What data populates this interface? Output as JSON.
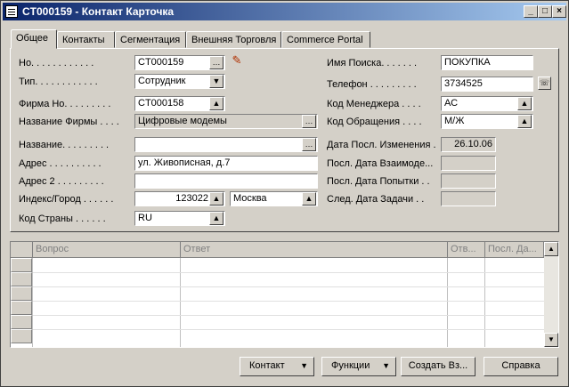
{
  "window": {
    "title": "CT000159 - Контакт Карточка",
    "controls": [
      "_",
      "□",
      "×"
    ]
  },
  "tabs": [
    {
      "label": "Общее"
    },
    {
      "label": "Контакты"
    },
    {
      "label": "Сегментация"
    },
    {
      "label": "Внешняя Торговля"
    },
    {
      "label": "Commerce Portal"
    }
  ],
  "general": {
    "no_label": "Но. . . . . . . . . . . .",
    "no_value": "CT000159",
    "type_label": "Тип. . . . . . . . . . . .",
    "type_value": "Сотрудник",
    "company_no_label": "Фирма Но. . . . . . . . .",
    "company_no_value": "CT000158",
    "company_name_label": "Название Фирмы . . . .",
    "company_name_value": "Цифровые модемы",
    "name_label": "Название. . . . . . . . .",
    "name_value": "",
    "address_label": "Адрес . . . . . . . . . .",
    "address_value": "ул. Живописная, д.7",
    "address2_label": "Адрес 2 . . . . . . . . .",
    "address2_value": "",
    "postcode_label": "Индекс/Город . . . . . .",
    "postcode_value": "123022",
    "city_value": "Москва",
    "country_label": "Код Страны . . . . . .",
    "country_value": "RU",
    "search_name_label": "Имя Поиска. . . . . . .",
    "search_name_value": "ПОКУПКА",
    "phone_label": "Телефон . . . . . . . . .",
    "phone_value": "3734525",
    "manager_label": "Код Менеджера . . . .",
    "manager_value": "АС",
    "salutation_label": "Код Обращения . . . .",
    "salutation_value": "М/Ж",
    "last_modified_label": "Дата Посл. Изменения .",
    "last_modified_value": "26.10.06",
    "last_interaction_label": "Посл. Дата Взаимоде...",
    "last_interaction_value": "",
    "last_attempt_label": "Посл. Дата Попытки . .",
    "last_attempt_value": "",
    "next_task_label": "След. Дата Задачи . .",
    "next_task_value": ""
  },
  "grid": {
    "columns": [
      "Вопрос",
      "Ответ",
      "Отв...",
      "Посл. Да..."
    ],
    "row_count": 6
  },
  "buttons": {
    "contact": "Контакт",
    "functions": "Функции",
    "create": "Создать Вз...",
    "help": "Справка"
  },
  "icons": {
    "lookup": "ellipsis-icon",
    "dropdown": "triangle-down-icon",
    "drilldown": "arrow-up-icon",
    "edit": "pencil-icon",
    "phone": "phone-dial-icon"
  }
}
